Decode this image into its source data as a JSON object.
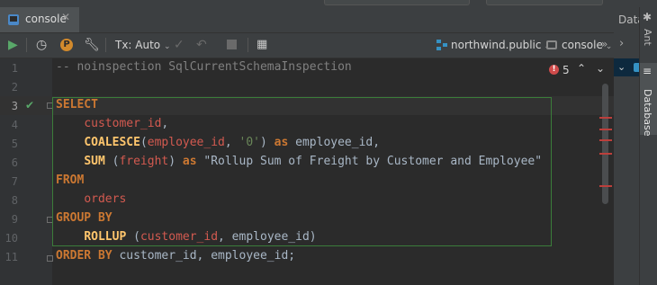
{
  "tab": {
    "label": "console",
    "close": "✕"
  },
  "right_panel": {
    "title": "Data",
    "tool_ant": "Ant",
    "tool_database": "Database"
  },
  "toolbar": {
    "tx_mode": "Tx: Auto",
    "schema": "northwind.public",
    "console": "console",
    "more": "»"
  },
  "inspection": {
    "count": "5"
  },
  "editor": {
    "line_numbers": [
      "1",
      "2",
      "3",
      "4",
      "5",
      "6",
      "7",
      "8",
      "9",
      "10",
      "11"
    ],
    "current_line": "3",
    "lines": {
      "l1": {
        "comment": "-- noinspection SqlCurrentSchemaInspection"
      },
      "l3": {
        "kw": "SELECT"
      },
      "l4": {
        "col": "customer_id",
        "punct": ","
      },
      "l5": {
        "fn": "COALESCE",
        "p1": "(",
        "col": "employee_id",
        "p2": ", ",
        "str": "'0'",
        "p3": ") ",
        "as": "as",
        "alias": " employee_id,"
      },
      "l6": {
        "fn": "SUM",
        "p1": " (",
        "col": "freight",
        "p2": ") ",
        "as": "as",
        "alias": " \"Rollup Sum of Freight by Customer and Employee\""
      },
      "l7": {
        "kw": "FROM"
      },
      "l8": {
        "table": "orders"
      },
      "l9": {
        "kw": "GROUP BY"
      },
      "l10": {
        "fn": "ROLLUP",
        "p1": " (",
        "col": "customer_id",
        "p2": ", employee_id)"
      },
      "l11": {
        "kw": "ORDER BY",
        "rest": " customer_id, employee_id;"
      }
    }
  },
  "colors": {
    "keyword": "#cc7832",
    "function": "#ffc66d",
    "identifier": "#d35a50",
    "string": "#6a8759",
    "comment": "#808080",
    "text": "#a9b7c6",
    "run": "#59a869"
  }
}
